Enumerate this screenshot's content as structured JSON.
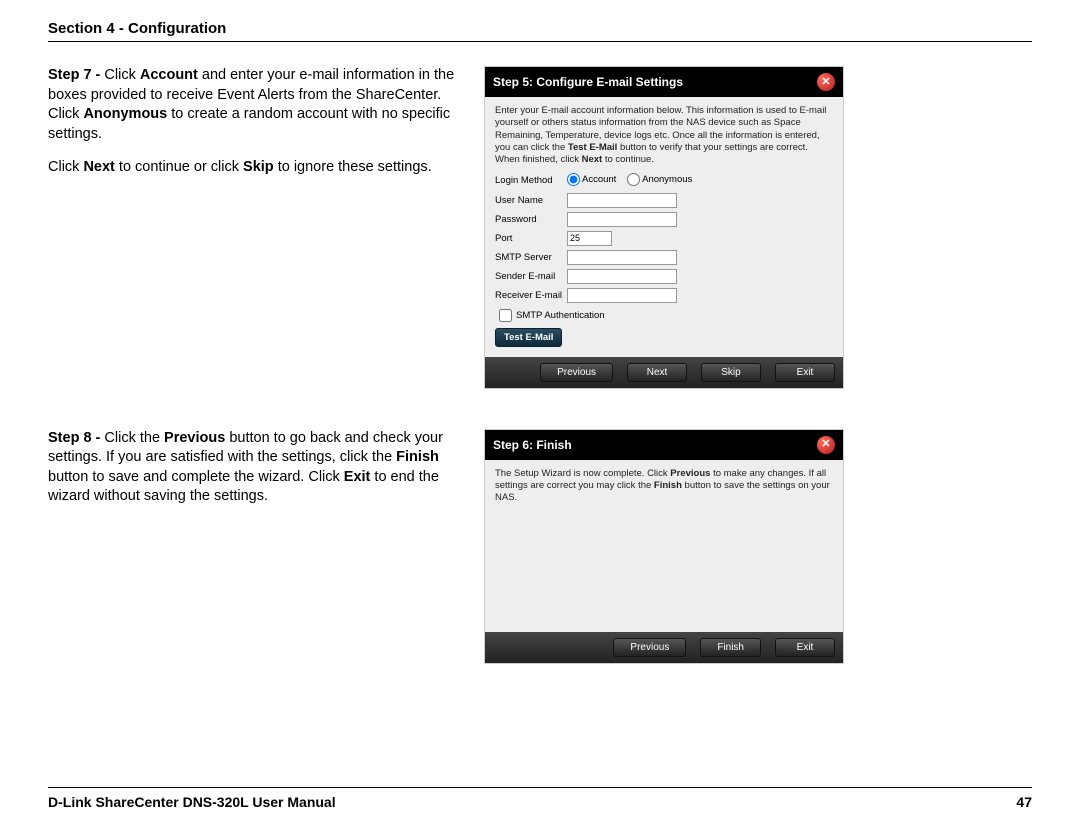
{
  "header": {
    "section_title": "Section 4 - Configuration"
  },
  "step7": {
    "prefix": "Step 7 - ",
    "t1": "Click ",
    "b1": "Account",
    "t2": " and enter your e-mail information in the boxes provided to receive Event Alerts from the ShareCenter. Click ",
    "b2": "Anonymous",
    "t3": " to create a random account with no specific settings.",
    "p2a": "Click ",
    "p2b1": "Next",
    "p2b": " to continue or click ",
    "p2b2": "Skip",
    "p2c": " to ignore these settings."
  },
  "dialog1": {
    "title": "Step 5: Configure E-mail Settings",
    "intro1": "Enter your E-mail account information below. This information is used to E-mail yourself or others status information from the NAS device such as Space Remaining, Temperature, device logs etc. Once all the information is entered, you can click the ",
    "intro_bold": "Test E-Mail",
    "intro2": " button to verify that your settings are correct. When finished, click ",
    "intro_bold2": "Next",
    "intro3": " to continue.",
    "labels": {
      "login_method": "Login Method",
      "account": "Account",
      "anonymous": "Anonymous",
      "username": "User Name",
      "password": "Password",
      "port": "Port",
      "port_value": "25",
      "smtp": "SMTP Server",
      "sender": "Sender E-mail",
      "receiver": "Receiver E-mail",
      "smtp_auth": "SMTP Authentication",
      "test_btn": "Test E-Mail"
    },
    "buttons": {
      "prev": "Previous",
      "next": "Next",
      "skip": "Skip",
      "exit": "Exit"
    }
  },
  "step8": {
    "prefix": "Step 8 - ",
    "t1": "Click the ",
    "b1": "Previous",
    "t2": " button to go back and check your settings. If you are satisfied with the settings, click the ",
    "b2": "Finish",
    "t3": " button to save and complete the wizard. Click ",
    "b3": "Exit",
    "t4": " to end the wizard without saving the settings."
  },
  "dialog2": {
    "title": "Step 6: Finish",
    "intro1": "The Setup Wizard is now complete. Click ",
    "intro_b1": "Previous",
    "intro2": " to make any changes. If all settings are correct you may click the ",
    "intro_b2": "Finish",
    "intro3": " button to save the settings on your NAS.",
    "buttons": {
      "prev": "Previous",
      "finish": "Finish",
      "exit": "Exit"
    }
  },
  "footer": {
    "manual": "D-Link ShareCenter DNS-320L User Manual",
    "page": "47"
  }
}
